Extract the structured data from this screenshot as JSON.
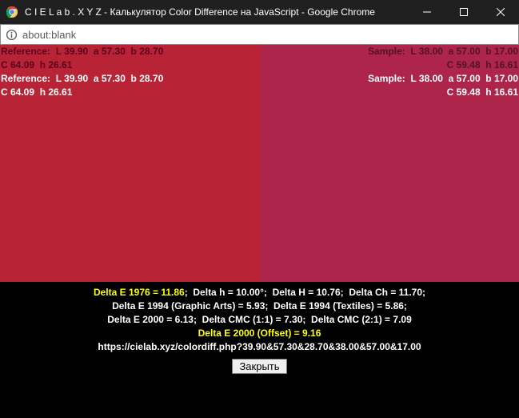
{
  "window": {
    "title": "C I E L a b . X Y Z - Калькулятор Color Difference на JavaScript - Google Chrome"
  },
  "address": {
    "url": "about:blank"
  },
  "reference": {
    "bg": "#b92336",
    "label_prefix": "Reference:",
    "line1": "Reference:  L 39.90  a 57.30  b 28.70",
    "line2": "C 64.09  h 26.61"
  },
  "sample": {
    "bg": "#ae254b",
    "label_prefix": "Sample:",
    "line1": "Sample:  L 38.00  a 57.00  b 17.00",
    "line2": "C 59.48  h 16.61"
  },
  "results": {
    "de76_label": "Delta E 1976 = 11.86",
    "dh_small": "Delta h = 10.00°",
    "dh_cap": "Delta H = 10.76",
    "dch": "Delta Ch = 11.70",
    "de94_ga": "Delta E 1994 (Graphic Arts) = 5.93",
    "de94_tex": "Delta E 1994 (Textiles) = 5.86",
    "de2000": "Delta E 2000 = 6.13",
    "dcmc11": "Delta CMC (1:1) = 7.30",
    "dcmc21": "Delta CMC (2:1) = 7.09",
    "de2000_offset": "Delta E 2000 (Offset) = 9.16",
    "url": "https://cielab.xyz/colordiff.php?39.90&57.30&28.70&38.00&57.00&17.00"
  },
  "buttons": {
    "close": "Закрыть"
  }
}
